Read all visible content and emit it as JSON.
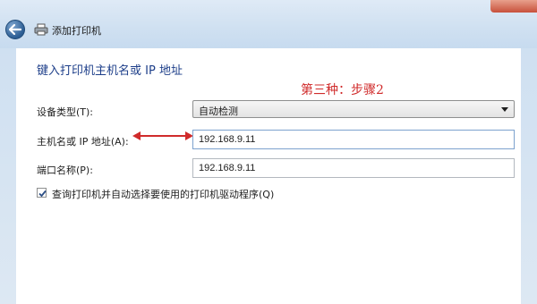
{
  "window": {
    "title": "添加打印机"
  },
  "page": {
    "heading": "键入打印机主机名或 IP 地址",
    "annotation": "第三种：步骤2"
  },
  "form": {
    "device_type_label": "设备类型(T):",
    "device_type_value": "自动检测",
    "hostname_label": "主机名或 IP 地址(A):",
    "hostname_value": "192.168.9.11",
    "port_label": "端口名称(P):",
    "port_value": "192.168.9.11",
    "query_checkbox_label": "查询打印机并自动选择要使用的打印机驱动程序(Q)",
    "query_checkbox_checked": true
  },
  "colors": {
    "heading": "#1e3f8a",
    "annotation": "#d02b2b",
    "titlebar": "#cfe0f1"
  }
}
